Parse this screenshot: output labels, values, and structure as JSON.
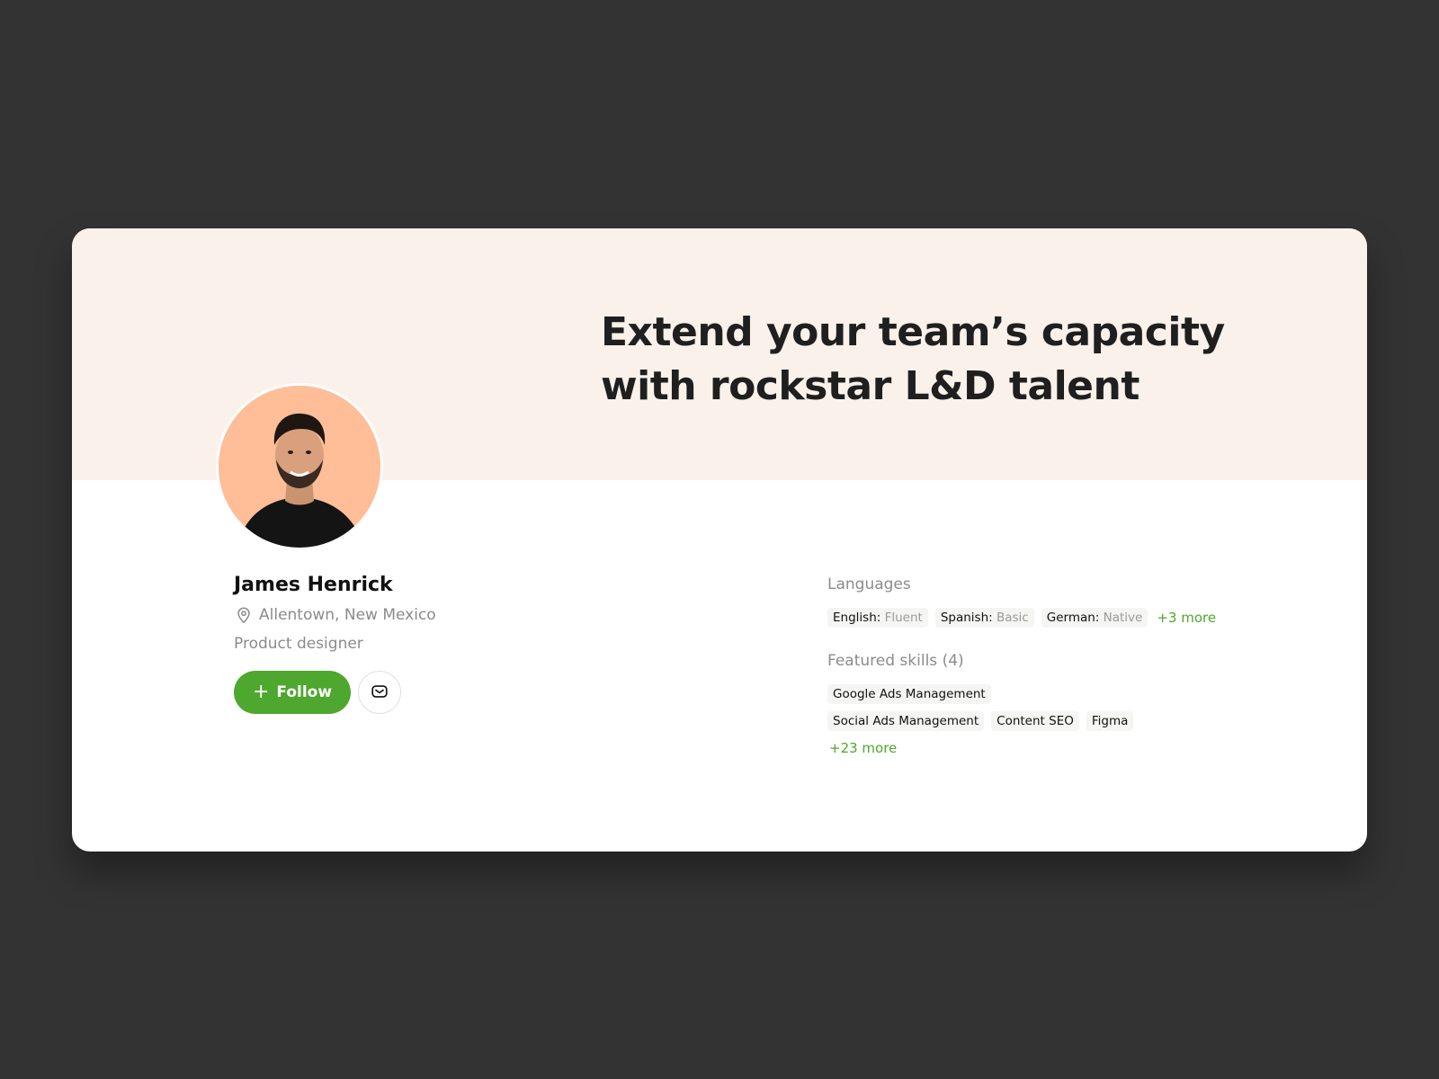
{
  "banner": {
    "headline_line1": "Extend your team’s capacity",
    "headline_line2": "with rockstar L&D talent"
  },
  "profile": {
    "name": "James Henrick",
    "location": "Allentown, New Mexico",
    "role": "Product designer",
    "follow_label": "Follow"
  },
  "languages": {
    "label": "Languages",
    "items": [
      {
        "name": "English:",
        "level": "Fluent"
      },
      {
        "name": "Spanish:",
        "level": "Basic"
      },
      {
        "name": "German:",
        "level": "Native"
      }
    ],
    "more": "+3 more"
  },
  "skills": {
    "label": "Featured skills (4)",
    "items": [
      "Google Ads Management",
      "Social Ads Management",
      "Content SEO",
      "Figma"
    ],
    "more": "+23 more"
  },
  "colors": {
    "accent": "#4ea72e",
    "banner_bg": "#f9f1ea",
    "avatar_bg": "#ffbd98",
    "page_bg": "#333333"
  },
  "icons": [
    "location-pin-icon",
    "plus-icon",
    "mail-icon"
  ]
}
